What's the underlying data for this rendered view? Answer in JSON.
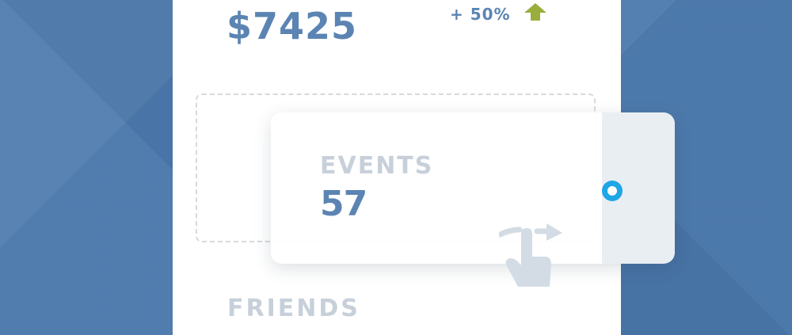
{
  "summary": {
    "amount": "$7425",
    "change": "+ 50%",
    "trend_icon": "up-arrow-icon",
    "trend_color": "#9aae3e"
  },
  "drag_card": {
    "label": "EVENTS",
    "value": "57",
    "handle_color": "#1ea6e6"
  },
  "friends": {
    "label": "FRIENDS"
  },
  "gesture": {
    "icon": "swipe-hand-icon"
  },
  "colors": {
    "background": "#4a78ac",
    "panel": "#ffffff",
    "primary_text": "#5b84b3",
    "muted_text": "#c7d0da"
  }
}
